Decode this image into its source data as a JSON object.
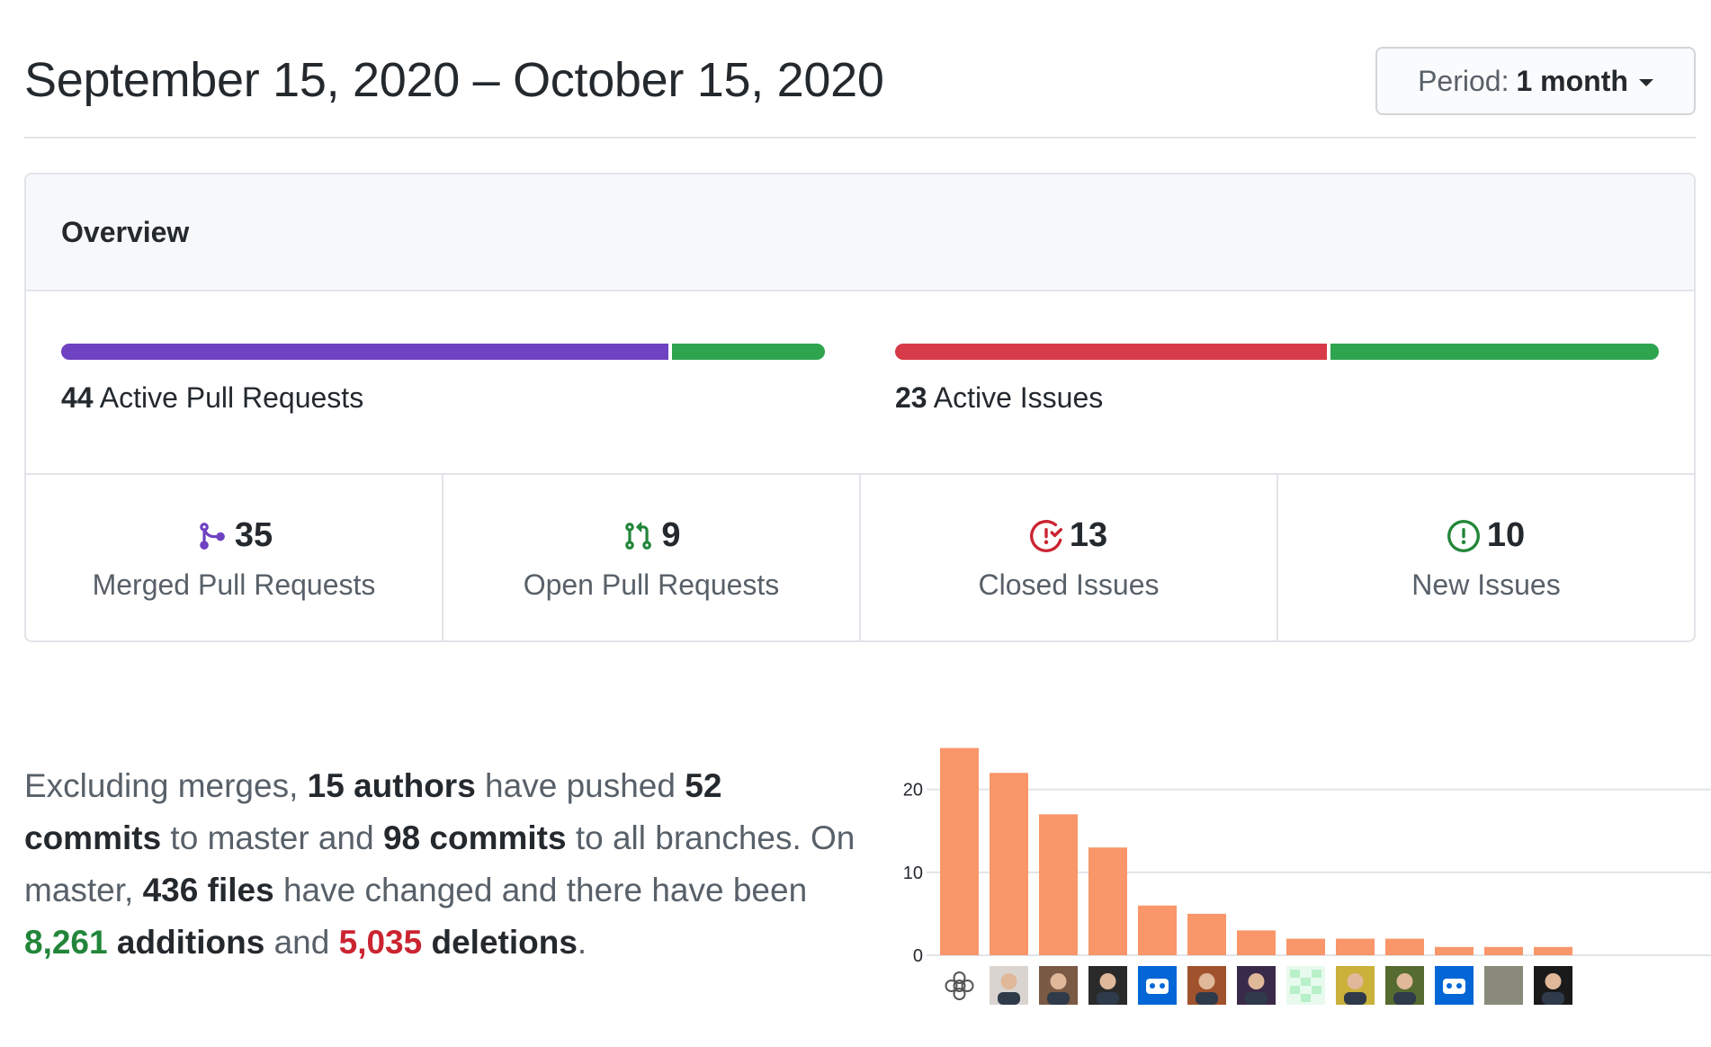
{
  "header": {
    "date_range": "September 15, 2020 – October 15, 2020",
    "period_label": "Period:",
    "period_value": "1 month"
  },
  "overview": {
    "title": "Overview",
    "pull_requests": {
      "count": "44",
      "label": "Active Pull Requests",
      "merged_fraction": 0.795,
      "colors": {
        "merged": "#6f42c1",
        "open": "#2ea44f"
      }
    },
    "issues": {
      "count": "23",
      "label": "Active Issues",
      "closed_fraction": 0.565,
      "colors": {
        "closed": "#d73a49",
        "new": "#2ea44f"
      }
    },
    "stats": [
      {
        "icon": "git-merge-icon",
        "count": "35",
        "label": "Merged Pull Requests",
        "color": "#6f42c1"
      },
      {
        "icon": "git-pull-request-icon",
        "count": "9",
        "label": "Open Pull Requests",
        "color": "#22863a"
      },
      {
        "icon": "issue-closed-icon",
        "count": "13",
        "label": "Closed Issues",
        "color": "#cb2431"
      },
      {
        "icon": "issue-opened-icon",
        "count": "10",
        "label": "New Issues",
        "color": "#22863a"
      }
    ]
  },
  "summary": {
    "p1": "Excluding merges, ",
    "authors": "15 authors",
    "p2": " have pushed ",
    "commits_master": "52 commits",
    "p3": " to master and ",
    "commits_all": "98 commits",
    "p4": " to all branches. On master, ",
    "files": "436 files",
    "p5": " have changed and there have been ",
    "additions_num": "8,261",
    "additions_word": "additions",
    "p6": " and ",
    "deletions_num": "5,035",
    "deletions_word": "deletions",
    "p7": "."
  },
  "chart_data": {
    "type": "bar",
    "categories": [
      "contributor-1",
      "contributor-2",
      "contributor-3",
      "contributor-4",
      "contributor-5",
      "contributor-6",
      "contributor-7",
      "contributor-8",
      "contributor-9",
      "contributor-10",
      "contributor-11",
      "contributor-12",
      "contributor-13"
    ],
    "values": [
      25,
      22,
      17,
      13,
      6,
      5,
      3,
      2,
      2,
      2,
      1,
      1,
      1
    ],
    "yticks": [
      0,
      10,
      20
    ],
    "ylim": [
      0,
      25
    ],
    "grid": true,
    "bar_color": "#f9966a",
    "avatars": [
      "knot-logo-avatar",
      "user-avatar",
      "user-avatar",
      "user-avatar",
      "bot-avatar",
      "user-avatar",
      "user-avatar",
      "identicon-avatar",
      "user-avatar",
      "user-avatar",
      "bot-avatar",
      "landscape-avatar",
      "user-avatar"
    ],
    "avatar_colors": [
      "#ffffff",
      "#d9d4cf",
      "#7a5a44",
      "#2a2a2a",
      "#0366d6",
      "#a0522d",
      "#3a2a4a",
      "#b8f0c8",
      "#c9b13a",
      "#556b2f",
      "#0366d6",
      "#8a8a7a",
      "#1a1a1a"
    ]
  }
}
